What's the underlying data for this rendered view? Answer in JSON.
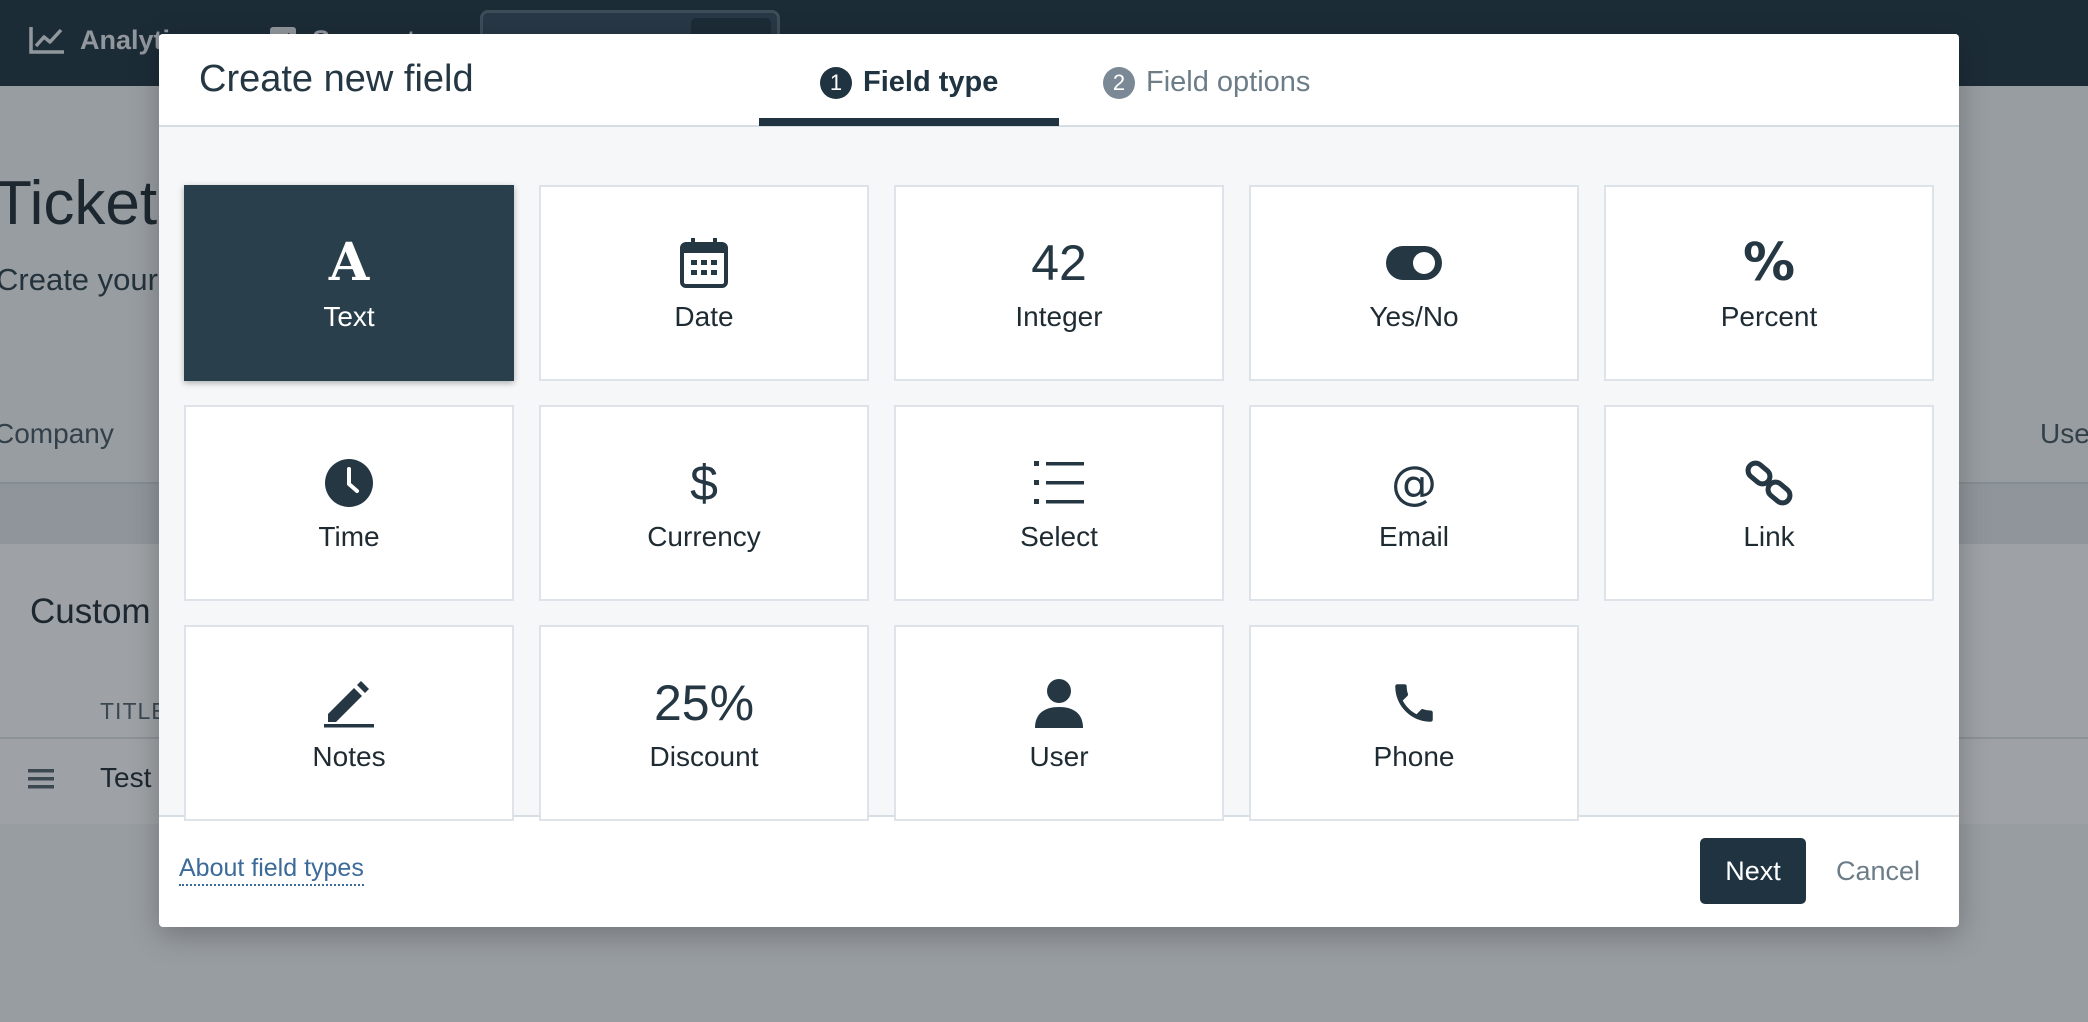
{
  "background": {
    "nav": [
      {
        "label": "Analytics",
        "icon": "chart-line-icon"
      },
      {
        "label": "Support",
        "icon": "check-square-icon"
      }
    ],
    "page_title": "Tickets",
    "page_subtitle": "Create your",
    "tabs": [
      "Company",
      "Users"
    ],
    "card_title": "Custom",
    "column_header": "TITLE",
    "row_value": "Test"
  },
  "modal": {
    "title": "Create new field",
    "steps": [
      {
        "number": "1",
        "label": "Field type",
        "active": true
      },
      {
        "number": "2",
        "label": "Field options",
        "active": false
      }
    ],
    "field_types": [
      {
        "label": "Text",
        "icon": "text-icon",
        "glyph": "A",
        "selected": true
      },
      {
        "label": "Date",
        "icon": "calendar-icon"
      },
      {
        "label": "Integer",
        "icon": "number-icon",
        "glyph": "42"
      },
      {
        "label": "Yes/No",
        "icon": "toggle-icon"
      },
      {
        "label": "Percent",
        "icon": "percent-icon",
        "glyph": "%"
      },
      {
        "label": "Time",
        "icon": "clock-icon"
      },
      {
        "label": "Currency",
        "icon": "dollar-icon",
        "glyph": "$"
      },
      {
        "label": "Select",
        "icon": "list-icon"
      },
      {
        "label": "Email",
        "icon": "at-sign-icon",
        "glyph": "@"
      },
      {
        "label": "Link",
        "icon": "link-icon"
      },
      {
        "label": "Notes",
        "icon": "pencil-icon"
      },
      {
        "label": "Discount",
        "icon": "discount-icon",
        "glyph": "25%"
      },
      {
        "label": "User",
        "icon": "user-icon"
      },
      {
        "label": "Phone",
        "icon": "phone-icon"
      }
    ],
    "footer": {
      "about_link": "About field types",
      "next_label": "Next",
      "cancel_label": "Cancel"
    }
  },
  "colors": {
    "primary": "#1f3440",
    "selected_tile": "#2a3f4c",
    "link": "#3c6a99",
    "muted": "#6c7d88"
  }
}
